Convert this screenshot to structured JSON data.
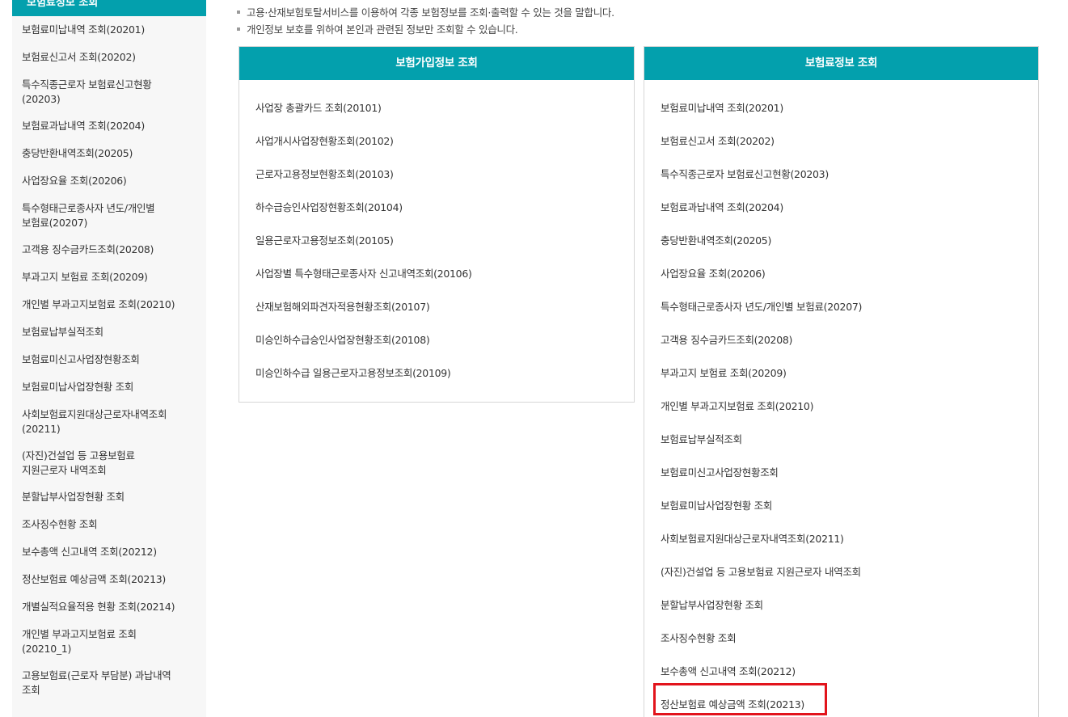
{
  "sidebar": {
    "header": "보험료정보 조회",
    "items": [
      {
        "lines": [
          "보험료미납내역 조회(20201)"
        ]
      },
      {
        "lines": [
          "보험료신고서 조회(20202)"
        ]
      },
      {
        "lines": [
          "특수직종근로자 보험료신고현황",
          "(20203)"
        ]
      },
      {
        "lines": [
          "보험료과납내역 조회(20204)"
        ]
      },
      {
        "lines": [
          "충당반환내역조회(20205)"
        ]
      },
      {
        "lines": [
          "사업장요율 조회(20206)"
        ]
      },
      {
        "lines": [
          "특수형태근로종사자 년도/개인별",
          "보험료(20207)"
        ]
      },
      {
        "lines": [
          "고객용 징수금카드조회(20208)"
        ]
      },
      {
        "lines": [
          "부과고지 보험료 조회(20209)"
        ]
      },
      {
        "lines": [
          "개인별 부과고지보험료 조회(20210)"
        ]
      },
      {
        "lines": [
          "보험료납부실적조회"
        ]
      },
      {
        "lines": [
          "보험료미신고사업장현황조회"
        ]
      },
      {
        "lines": [
          "보험료미납사업장현황 조회"
        ]
      },
      {
        "lines": [
          "사회보험료지원대상근로자내역조회",
          "(20211)"
        ]
      },
      {
        "lines": [
          "(자진)건설업 등 고용보험료",
          "지원근로자 내역조회"
        ]
      },
      {
        "lines": [
          "분할납부사업장현황 조회"
        ]
      },
      {
        "lines": [
          "조사징수현황 조회"
        ]
      },
      {
        "lines": [
          "보수총액 신고내역 조회(20212)"
        ]
      },
      {
        "lines": [
          "정산보험료 예상금액 조회(20213)"
        ]
      },
      {
        "lines": [
          "개별실적요율적용 현황 조회(20214)"
        ]
      },
      {
        "lines": [
          "개인별 부과고지보험료 조회",
          "(20210_1)"
        ]
      },
      {
        "lines": [
          "고용보험료(근로자 부담분) 과납내역",
          "조회"
        ]
      }
    ]
  },
  "notes": [
    "고용·산재보험토탈서비스를 이용하여 각종 보험정보를 조회·출력할 수 있는 것을 말합니다.",
    "개인정보 보호를 위하여 본인과 관련된 정보만 조회할 수 있습니다."
  ],
  "panels": {
    "insurance_join": {
      "title": "보험가입정보 조회",
      "items": [
        "사업장 총괄카드 조회(20101)",
        "사업개시사업장현황조회(20102)",
        "근로자고용정보현황조회(20103)",
        "하수급승인사업장현황조회(20104)",
        "일용근로자고용정보조회(20105)",
        "사업장별 특수형태근로종사자 신고내역조회(20106)",
        "산재보험해외파견자적용현황조회(20107)",
        "미승인하수급승인사업장현황조회(20108)",
        "미승인하수급 일용근로자고용정보조회(20109)"
      ]
    },
    "premium_info": {
      "title": "보험료정보 조회",
      "items": [
        "보험료미납내역 조회(20201)",
        "보험료신고서 조회(20202)",
        "특수직종근로자 보험료신고현황(20203)",
        "보험료과납내역 조회(20204)",
        "충당반환내역조회(20205)",
        "사업장요율 조회(20206)",
        "특수형태근로종사자 년도/개인별 보험료(20207)",
        "고객용 징수금카드조회(20208)",
        "부과고지 보험료 조회(20209)",
        "개인별 부과고지보험료 조회(20210)",
        "보험료납부실적조회",
        "보험료미신고사업장현황조회",
        "보험료미납사업장현황 조회",
        "사회보험료지원대상근로자내역조회(20211)",
        "(자진)건설업 등 고용보험료 지원근로자 내역조회",
        "분할납부사업장현황 조회",
        "조사징수현황 조회",
        "보수총액 신고내역 조회(20212)",
        "정산보험료 예상금액 조회(20213)"
      ]
    }
  },
  "colors": {
    "accent": "#03a0ad",
    "highlight": "#e2141c",
    "sidebar_bg": "#f7f7f7"
  }
}
